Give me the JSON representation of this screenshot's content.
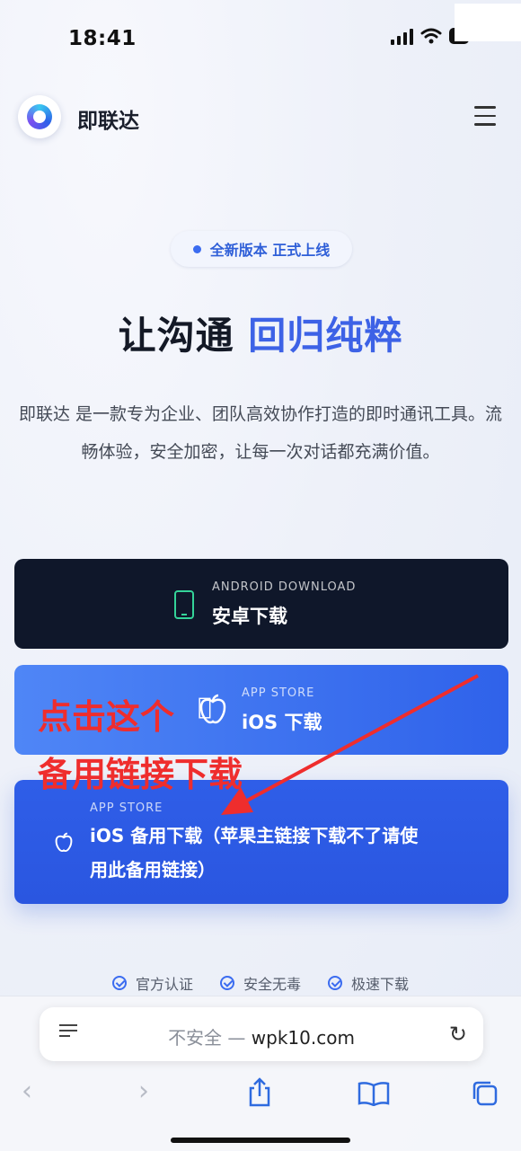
{
  "status": {
    "time": "18:41",
    "battery": "6"
  },
  "header": {
    "brand": "即联达"
  },
  "badge": {
    "text": "全新版本 正式上线"
  },
  "headline": {
    "part1": "让沟通 ",
    "part2": "回归纯粹"
  },
  "description": "即联达 是一款专为企业、团队高效协作打造的即时通讯工具。流畅体验，安全加密，让每一次对话都充满价值。",
  "buttons": {
    "android": {
      "sub": "ANDROID DOWNLOAD",
      "label": "安卓下载"
    },
    "ios": {
      "sub": "APP STORE",
      "label": "iOS 下载"
    },
    "backup": {
      "sub": "APP STORE",
      "label_line1": "iOS 备用下载（苹果主链接下载不了请使",
      "label_line2": "用此备用链接）"
    }
  },
  "annotation": {
    "line1": "点击这个",
    "line2": "备用链接下载",
    "color": "#ef2d2d"
  },
  "features": [
    {
      "label": "官方认证"
    },
    {
      "label": "安全无毒"
    },
    {
      "label": "极速下载"
    }
  ],
  "browser": {
    "insecure": "不安全 — ",
    "domain": "wpk10.com"
  },
  "colors": {
    "accent": "#3d62e6",
    "dark_button": "#0f172a",
    "android_green": "#34d399"
  }
}
